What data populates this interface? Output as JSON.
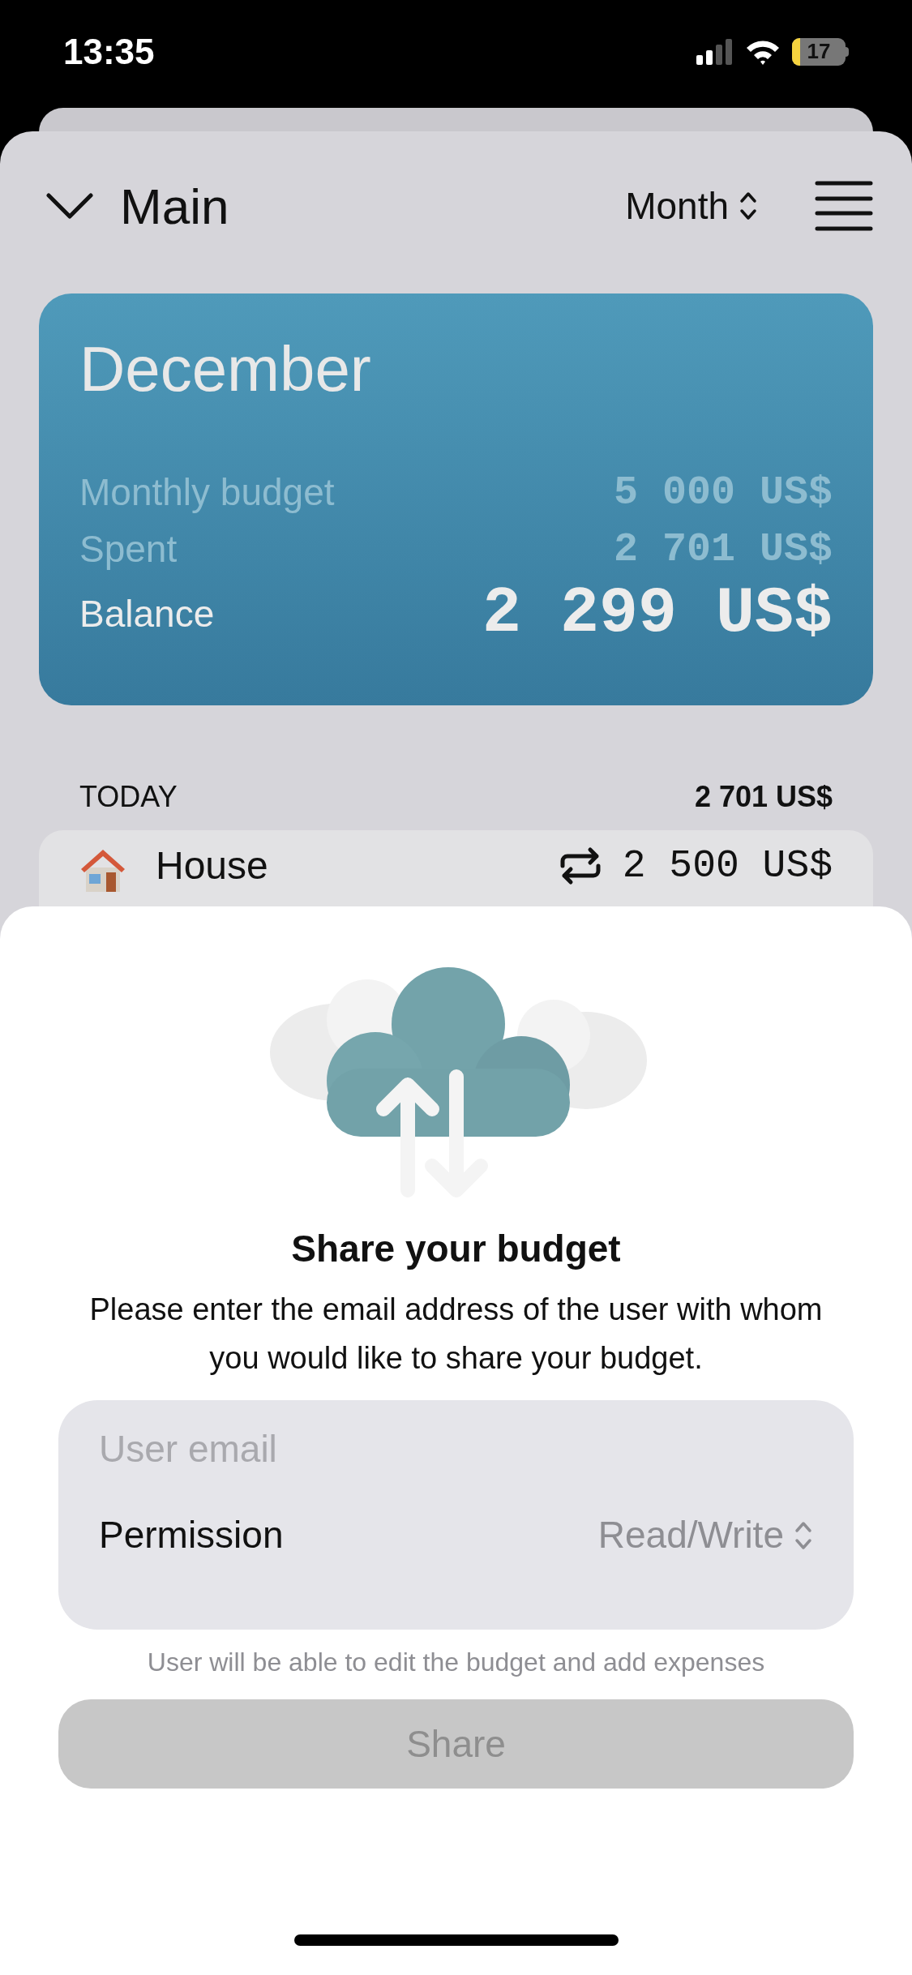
{
  "status_bar": {
    "time": "13:35",
    "battery": "17"
  },
  "header": {
    "title": "Main",
    "period": "Month"
  },
  "summary": {
    "month": "December",
    "rows": [
      {
        "kind": "minor",
        "label": "Monthly budget",
        "value": "5 000 US$"
      },
      {
        "kind": "minor",
        "label": "Spent",
        "value": "2 701 US$"
      },
      {
        "kind": "total",
        "label": "Balance",
        "value": "2 299 US$"
      }
    ]
  },
  "section": {
    "label": "TODAY",
    "total": "2 701 US$"
  },
  "expenses": [
    {
      "name": "House",
      "amount": "2 500 US$",
      "recurring": true
    }
  ],
  "share_sheet": {
    "title": "Share your budget",
    "description": "Please enter the email address of the user with whom you would like to share your budget.",
    "email_field": {
      "placeholder": "User email"
    },
    "permission": {
      "label": "Permission",
      "value": "Read/Write"
    },
    "hint": "User will be able to edit the budget and add expenses",
    "share_button": {
      "label": "Share",
      "disabled": true
    }
  }
}
